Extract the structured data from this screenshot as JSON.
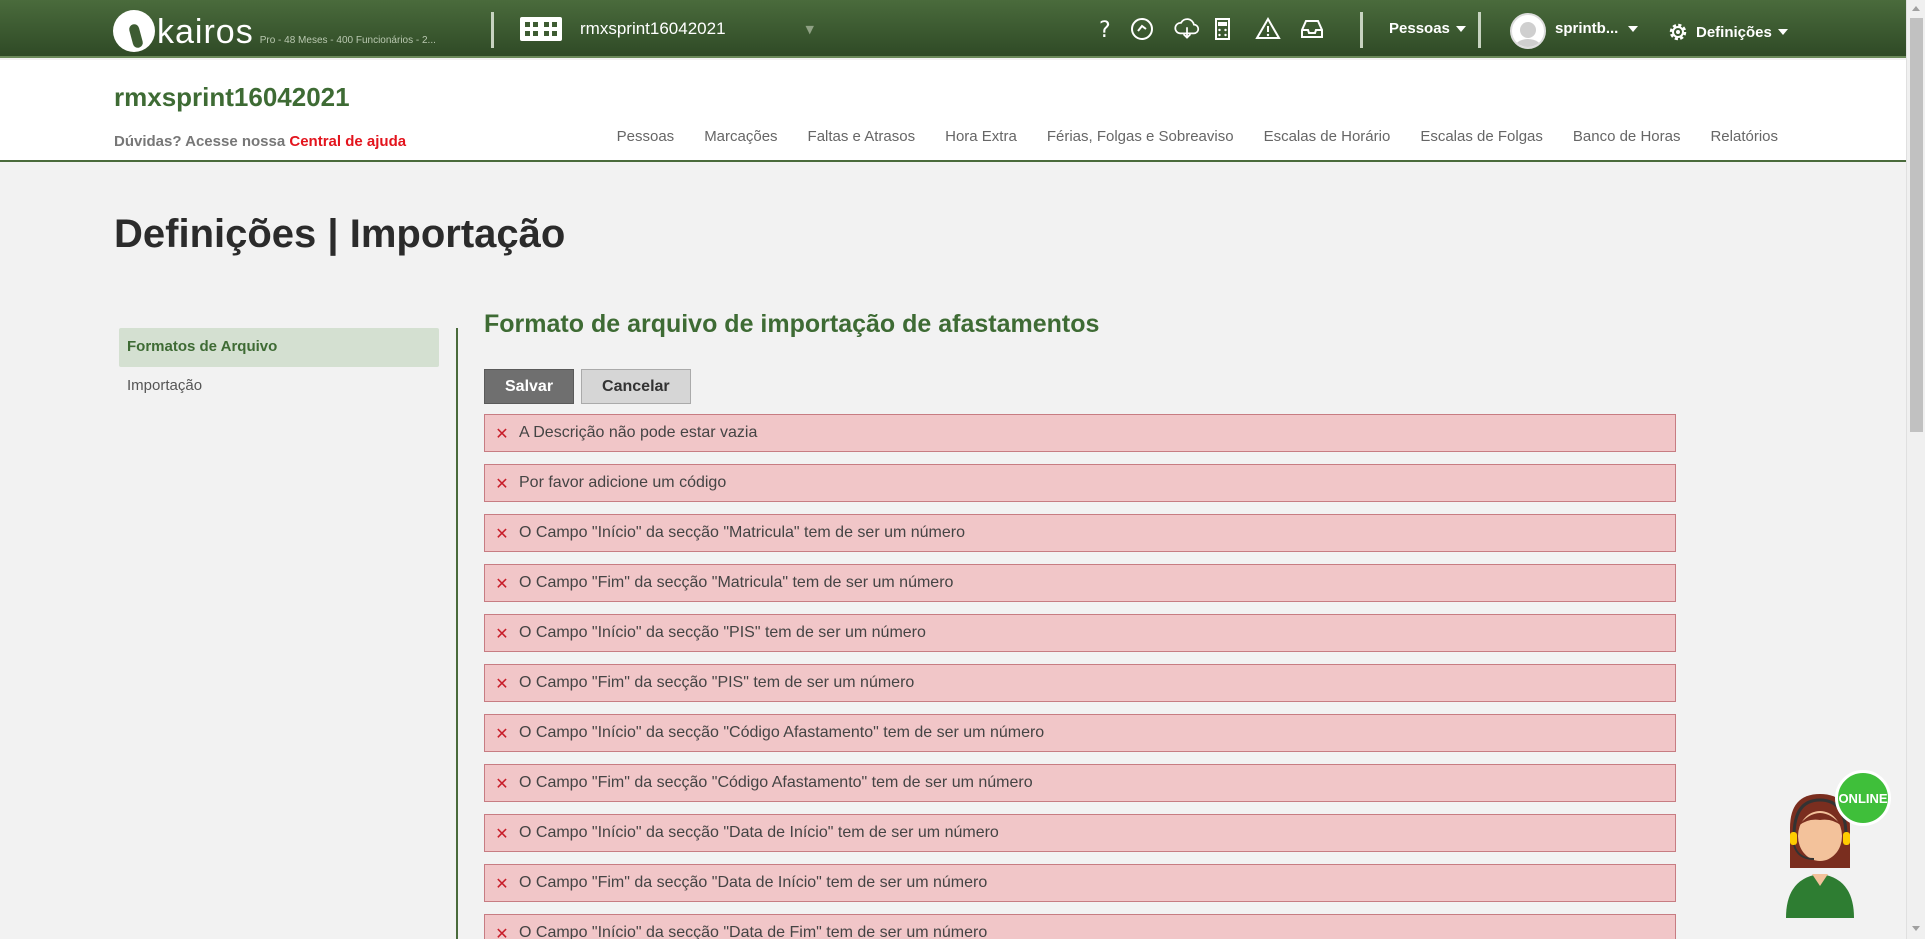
{
  "topbar": {
    "logo_text": "kairos",
    "plan_text": "Pro - 48 Meses - 400 Funcionários - 2...",
    "company_name": "rmxsprint16042021",
    "pessoas_label": "Pessoas",
    "user_label": "sprintb...",
    "settings_label": "Definições"
  },
  "header": {
    "title": "rmxsprint16042021",
    "help_prefix": "Dúvidas? Acesse nossa",
    "help_link": "Central de ajuda",
    "nav": [
      "Pessoas",
      "Marcações",
      "Faltas e Atrasos",
      "Hora Extra",
      "Férias, Folgas e Sobreaviso",
      "Escalas de Horário",
      "Escalas de Folgas",
      "Banco de Horas",
      "Relatórios"
    ]
  },
  "page": {
    "title": "Definições | Importação",
    "sidebar": [
      "Formatos de Arquivo",
      "Importação"
    ],
    "content_title": "Formato de arquivo de importação de afastamentos",
    "save_label": "Salvar",
    "cancel_label": "Cancelar",
    "errors": [
      "A Descrição não pode estar vazia",
      "Por favor adicione um código",
      "O Campo \"Início\" da secção \"Matricula\" tem de ser um número",
      "O Campo \"Fim\" da secção \"Matricula\" tem de ser um número",
      "O Campo \"Início\" da secção \"PIS\" tem de ser um número",
      "O Campo \"Fim\" da secção \"PIS\" tem de ser um número",
      "O Campo \"Início\" da secção \"Código Afastamento\" tem de ser um número",
      "O Campo \"Fim\" da secção \"Código Afastamento\" tem de ser um número",
      "O Campo \"Início\" da secção \"Data de Início\" tem de ser um número",
      "O Campo \"Fim\" da secção \"Data de Início\" tem de ser um número",
      "O Campo \"Início\" da secção \"Data de Fim\" tem de ser um número"
    ]
  },
  "chat": {
    "status_label": "ONLINE"
  },
  "colors": {
    "brand_green": "#3e6b34",
    "topbar": "#3d5c32",
    "error_bg": "#f1c6c8",
    "error_x": "#c81e2a",
    "help_link": "#e3141d"
  }
}
